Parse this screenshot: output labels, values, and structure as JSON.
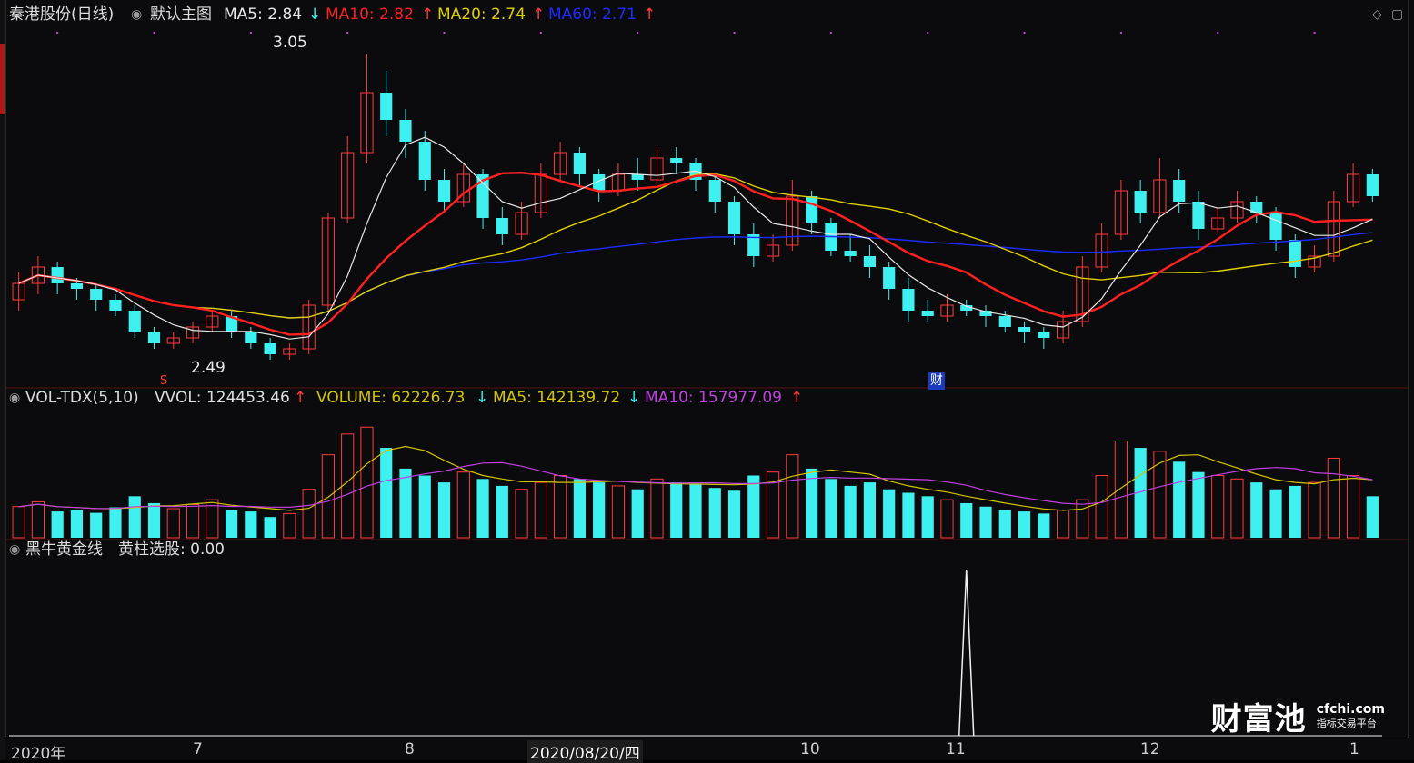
{
  "header": {
    "stock": "秦港股份(日线)",
    "template": "默认主图",
    "ma5": "MA5: 2.84",
    "ma10": "MA10: 2.82",
    "ma20": "MA20: 2.74",
    "ma60": "MA60: 2.71",
    "arrow_down": "↓",
    "arrow_up": "↑"
  },
  "price_panel": {
    "high_label": "3.05",
    "low_label": "2.49",
    "event_marker": "财",
    "s_marker": "S"
  },
  "volume_panel": {
    "name": "VOL-TDX(5,10)",
    "vvol": "VVOL: 124453.46",
    "volume": "VOLUME: 62226.73",
    "ma5": "MA5: 142139.72",
    "ma10": "MA10: 157977.09"
  },
  "indicator_panel": {
    "name": "黑牛黄金线",
    "value": "黄柱选股: 0.00"
  },
  "xaxis": {
    "ticks": [
      "2020年",
      "7",
      "8",
      "2020/08/20/四",
      "10",
      "11",
      "12",
      "1"
    ]
  },
  "brand": {
    "name": "财富池",
    "site": "cfchi.com",
    "tagline": "指标交易平台"
  },
  "colors": {
    "up": "#ff3b3b",
    "down": "#3ff0f0",
    "ma5": "#e8e8e8",
    "ma10": "#ff2020",
    "ma20": "#e0d000",
    "ma60": "#1a2cff",
    "vol_ma5": "#d4c400",
    "vol_ma10": "#c040e0"
  },
  "chart_data": {
    "type": "candlestick",
    "title": "秦港股份(日线)",
    "candles": [
      [
        2.6,
        2.63,
        2.65,
        2.58
      ],
      [
        2.63,
        2.66,
        2.68,
        2.61
      ],
      [
        2.66,
        2.63,
        2.67,
        2.61
      ],
      [
        2.63,
        2.62,
        2.64,
        2.6
      ],
      [
        2.62,
        2.6,
        2.63,
        2.58
      ],
      [
        2.6,
        2.58,
        2.61,
        2.57
      ],
      [
        2.58,
        2.54,
        2.59,
        2.53
      ],
      [
        2.54,
        2.52,
        2.55,
        2.51
      ],
      [
        2.52,
        2.53,
        2.54,
        2.51
      ],
      [
        2.53,
        2.55,
        2.56,
        2.52
      ],
      [
        2.55,
        2.57,
        2.58,
        2.54
      ],
      [
        2.57,
        2.54,
        2.58,
        2.53
      ],
      [
        2.54,
        2.52,
        2.55,
        2.51
      ],
      [
        2.52,
        2.5,
        2.53,
        2.49
      ],
      [
        2.5,
        2.51,
        2.52,
        2.49
      ],
      [
        2.51,
        2.59,
        2.6,
        2.5
      ],
      [
        2.59,
        2.75,
        2.76,
        2.58
      ],
      [
        2.75,
        2.87,
        2.9,
        2.74
      ],
      [
        2.87,
        2.98,
        3.05,
        2.85
      ],
      [
        2.98,
        2.93,
        3.02,
        2.9
      ],
      [
        2.93,
        2.89,
        2.95,
        2.86
      ],
      [
        2.89,
        2.82,
        2.91,
        2.8
      ],
      [
        2.82,
        2.78,
        2.84,
        2.76
      ],
      [
        2.78,
        2.83,
        2.85,
        2.77
      ],
      [
        2.83,
        2.75,
        2.84,
        2.73
      ],
      [
        2.75,
        2.72,
        2.77,
        2.7
      ],
      [
        2.72,
        2.76,
        2.78,
        2.71
      ],
      [
        2.76,
        2.83,
        2.85,
        2.75
      ],
      [
        2.83,
        2.87,
        2.89,
        2.82
      ],
      [
        2.87,
        2.83,
        2.88,
        2.81
      ],
      [
        2.83,
        2.8,
        2.84,
        2.78
      ],
      [
        2.8,
        2.83,
        2.85,
        2.79
      ],
      [
        2.83,
        2.82,
        2.86,
        2.8
      ],
      [
        2.82,
        2.86,
        2.88,
        2.81
      ],
      [
        2.86,
        2.85,
        2.88,
        2.83
      ],
      [
        2.85,
        2.82,
        2.86,
        2.8
      ],
      [
        2.82,
        2.78,
        2.83,
        2.76
      ],
      [
        2.78,
        2.72,
        2.79,
        2.7
      ],
      [
        2.72,
        2.68,
        2.74,
        2.66
      ],
      [
        2.68,
        2.7,
        2.72,
        2.67
      ],
      [
        2.7,
        2.79,
        2.82,
        2.69
      ],
      [
        2.79,
        2.74,
        2.8,
        2.72
      ],
      [
        2.74,
        2.69,
        2.75,
        2.68
      ],
      [
        2.69,
        2.68,
        2.72,
        2.67
      ],
      [
        2.68,
        2.66,
        2.7,
        2.64
      ],
      [
        2.66,
        2.62,
        2.67,
        2.6
      ],
      [
        2.62,
        2.58,
        2.64,
        2.56
      ],
      [
        2.58,
        2.57,
        2.6,
        2.56
      ],
      [
        2.57,
        2.59,
        2.61,
        2.56
      ],
      [
        2.59,
        2.58,
        2.6,
        2.57
      ],
      [
        2.58,
        2.57,
        2.59,
        2.55
      ],
      [
        2.57,
        2.55,
        2.58,
        2.54
      ],
      [
        2.55,
        2.54,
        2.56,
        2.52
      ],
      [
        2.54,
        2.53,
        2.55,
        2.51
      ],
      [
        2.53,
        2.56,
        2.58,
        2.52
      ],
      [
        2.56,
        2.66,
        2.68,
        2.55
      ],
      [
        2.66,
        2.72,
        2.74,
        2.65
      ],
      [
        2.72,
        2.8,
        2.82,
        2.71
      ],
      [
        2.8,
        2.76,
        2.82,
        2.74
      ],
      [
        2.76,
        2.82,
        2.86,
        2.75
      ],
      [
        2.82,
        2.78,
        2.84,
        2.76
      ],
      [
        2.78,
        2.73,
        2.8,
        2.71
      ],
      [
        2.73,
        2.75,
        2.77,
        2.72
      ],
      [
        2.75,
        2.78,
        2.8,
        2.74
      ],
      [
        2.78,
        2.76,
        2.79,
        2.74
      ],
      [
        2.76,
        2.71,
        2.77,
        2.69
      ],
      [
        2.71,
        2.66,
        2.72,
        2.64
      ],
      [
        2.66,
        2.68,
        2.7,
        2.65
      ],
      [
        2.68,
        2.78,
        2.8,
        2.67
      ],
      [
        2.78,
        2.83,
        2.85,
        2.77
      ],
      [
        2.83,
        2.79,
        2.84,
        2.78
      ]
    ],
    "ma5_last": 2.84,
    "ma10_last": 2.82,
    "ma20_last": 2.74,
    "ma60_last": 2.71,
    "ylim": [
      2.45,
      3.1
    ],
    "max_price": 3.05,
    "min_price": 2.49,
    "volume": [
      45,
      52,
      38,
      40,
      36,
      44,
      60,
      50,
      42,
      48,
      55,
      40,
      38,
      30,
      35,
      70,
      120,
      150,
      160,
      130,
      100,
      90,
      80,
      95,
      85,
      75,
      70,
      80,
      90,
      85,
      80,
      75,
      70,
      85,
      80,
      78,
      72,
      68,
      90,
      95,
      120,
      100,
      85,
      75,
      80,
      70,
      65,
      60,
      55,
      50,
      45,
      40,
      38,
      35,
      40,
      55,
      90,
      140,
      130,
      125,
      110,
      95,
      90,
      85,
      80,
      70,
      75,
      80,
      115,
      90,
      60
    ],
    "volume_ylim": [
      0,
      180
    ]
  }
}
